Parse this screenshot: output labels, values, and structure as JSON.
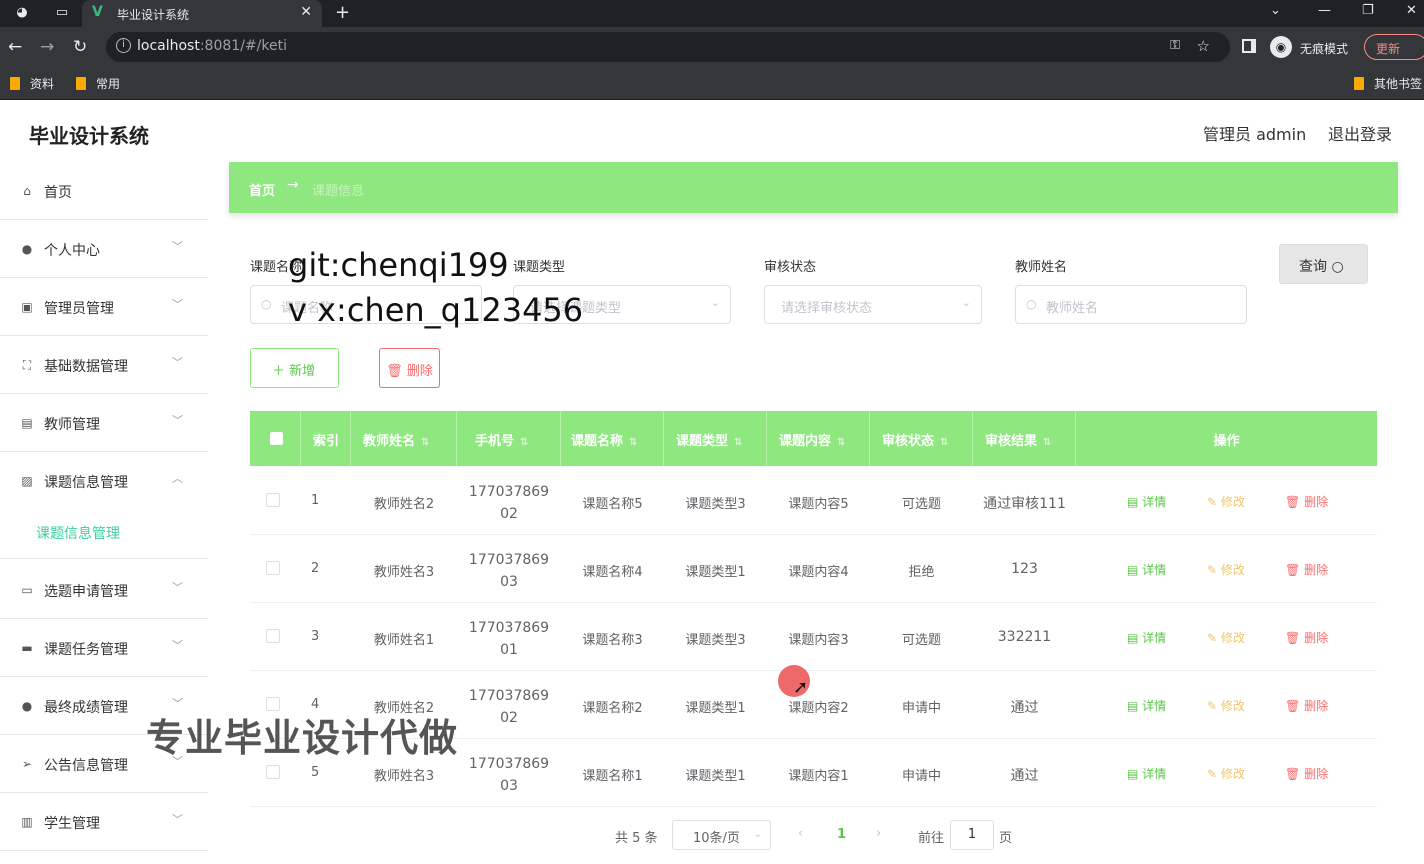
{
  "browser": {
    "tab_title": "毕业设计系统",
    "url_host": "localhost",
    "url_rest": ":8081/#/keti",
    "incognito_label": "无痕模式",
    "update_label": "更新",
    "bookmarks": [
      "资料",
      "常用"
    ],
    "other_bookmarks": "其他书签"
  },
  "header": {
    "brand": "毕业设计系统",
    "user": "管理员 admin",
    "logout": "退出登录"
  },
  "sidebar": {
    "items": [
      {
        "label": "首页",
        "icon": "home-icon"
      },
      {
        "label": "个人中心",
        "icon": "user-icon"
      },
      {
        "label": "管理员管理",
        "icon": "clipboard-icon"
      },
      {
        "label": "基础数据管理",
        "icon": "frame-icon"
      },
      {
        "label": "教师管理",
        "icon": "card-icon"
      },
      {
        "label": "课题信息管理",
        "icon": "chart-icon"
      },
      {
        "label": "选题申请管理",
        "icon": "chat-icon"
      },
      {
        "label": "课题任务管理",
        "icon": "monitor-icon"
      },
      {
        "label": "最终成绩管理",
        "icon": "bulb-icon"
      },
      {
        "label": "公告信息管理",
        "icon": "send-icon"
      },
      {
        "label": "学生管理",
        "icon": "bars-icon"
      }
    ],
    "active_sub": "课题信息管理"
  },
  "breadcrumb": {
    "home": "首页",
    "current": "课题信息"
  },
  "filters": {
    "topic_name_label": "课题名称",
    "topic_name_placeholder": "课题名称",
    "topic_type_label": "课题类型",
    "topic_type_placeholder": "请选择课题类型",
    "review_status_label": "审核状态",
    "review_status_placeholder": "请选择审核状态",
    "teacher_name_label": "教师姓名",
    "teacher_name_placeholder": "教师姓名",
    "query_button": "查询"
  },
  "actions": {
    "add": "新增",
    "delete": "删除"
  },
  "table": {
    "headers": [
      "索引",
      "教师姓名",
      "手机号",
      "课题名称",
      "课题类型",
      "课题内容",
      "审核状态",
      "审核结果",
      "操作"
    ],
    "row_actions": {
      "detail": "详情",
      "edit": "修改",
      "delete": "删除"
    },
    "rows": [
      {
        "index": "1",
        "teacher": "教师姓名2",
        "phone1": "177037869",
        "phone2": "02",
        "name": "课题名称5",
        "type": "课题类型3",
        "content": "课题内容5",
        "status": "可选题",
        "result": "通过审核111"
      },
      {
        "index": "2",
        "teacher": "教师姓名3",
        "phone1": "177037869",
        "phone2": "03",
        "name": "课题名称4",
        "type": "课题类型1",
        "content": "课题内容4",
        "status": "拒绝",
        "result": "123"
      },
      {
        "index": "3",
        "teacher": "教师姓名1",
        "phone1": "177037869",
        "phone2": "01",
        "name": "课题名称3",
        "type": "课题类型3",
        "content": "课题内容3",
        "status": "可选题",
        "result": "332211"
      },
      {
        "index": "4",
        "teacher": "教师姓名2",
        "phone1": "177037869",
        "phone2": "02",
        "name": "课题名称2",
        "type": "课题类型1",
        "content": "课题内容2",
        "status": "申请中",
        "result": "通过"
      },
      {
        "index": "5",
        "teacher": "教师姓名3",
        "phone1": "177037869",
        "phone2": "03",
        "name": "课题名称1",
        "type": "课题类型1",
        "content": "课题内容1",
        "status": "申请中",
        "result": "通过"
      }
    ]
  },
  "pagination": {
    "total": "共 5 条",
    "page_size": "10条/页",
    "current_page": "1",
    "goto_label": "前往",
    "goto_value": "1",
    "page_unit": "页"
  },
  "overlays": {
    "wm_git": "git:chenqi199",
    "wm_vx": "v x:chen_q123456",
    "wm_ad": "专业毕业设计代做"
  },
  "colors": {
    "accent": "#8fe87f",
    "danger": "#f56c6c",
    "warning": "#f0c66e",
    "active_menu": "#3ccfa0"
  }
}
